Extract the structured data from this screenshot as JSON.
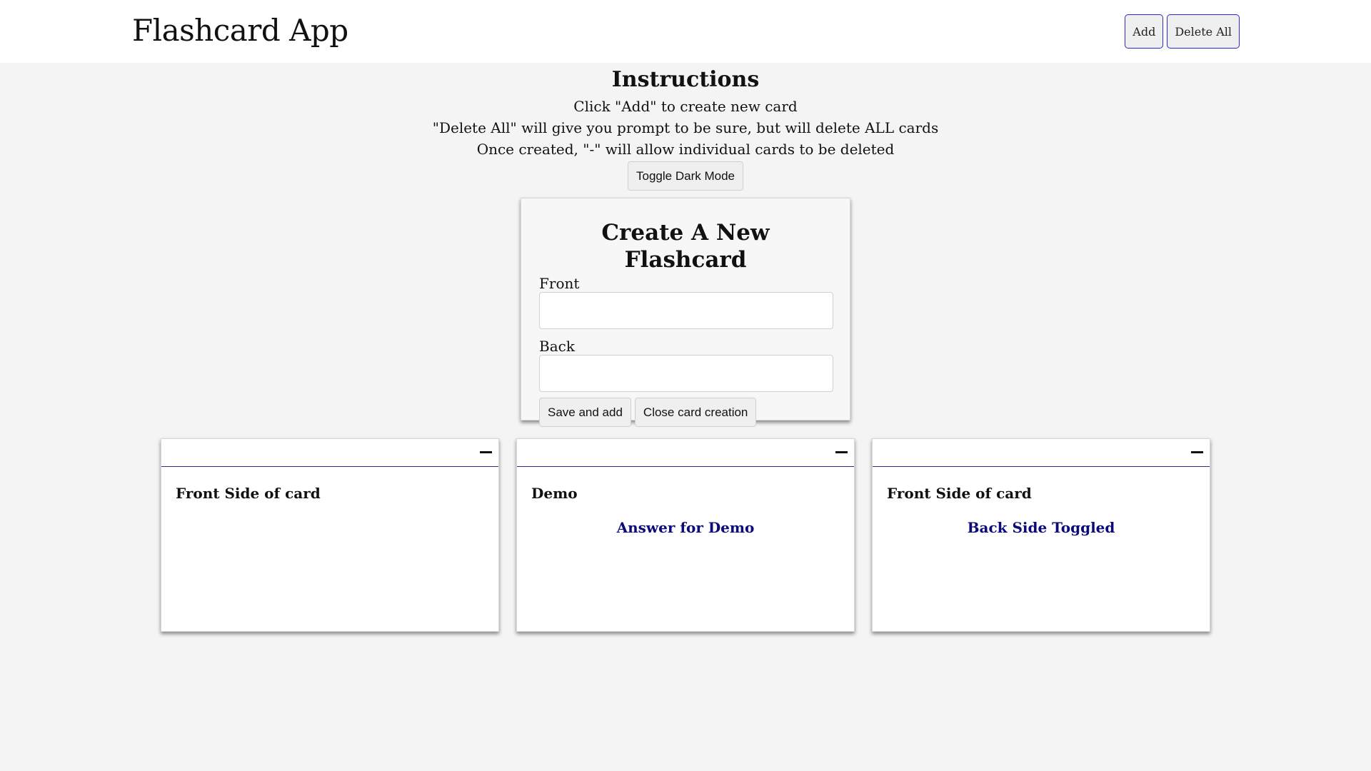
{
  "header": {
    "title": "Flashcard App",
    "add_label": "Add",
    "delete_all_label": "Delete All"
  },
  "instructions": {
    "heading": "Instructions",
    "lines": [
      "Click \"Add\" to create new card",
      "\"Delete All\" will give you prompt to be sure, but will delete ALL cards",
      "Once created, \"-\" will allow individual cards to be deleted"
    ],
    "toggle_label": "Toggle Dark Mode"
  },
  "create_panel": {
    "title": "Create A New Flashcard",
    "front_label": "Front",
    "front_value": "",
    "back_label": "Back",
    "back_value": "",
    "save_label": "Save and add",
    "close_label": "Close card creation"
  },
  "cards": [
    {
      "front": "Front Side of card",
      "back": ""
    },
    {
      "front": "Demo",
      "back": "Answer for Demo"
    },
    {
      "front": "Front Side of card",
      "back": "Back Side Toggled"
    }
  ],
  "colors": {
    "accent_border": "#2a2acb",
    "back_text": "#0a0a7a",
    "page_bg": "#f4f4f4"
  },
  "icons": {
    "delete_card": "minus-icon"
  }
}
